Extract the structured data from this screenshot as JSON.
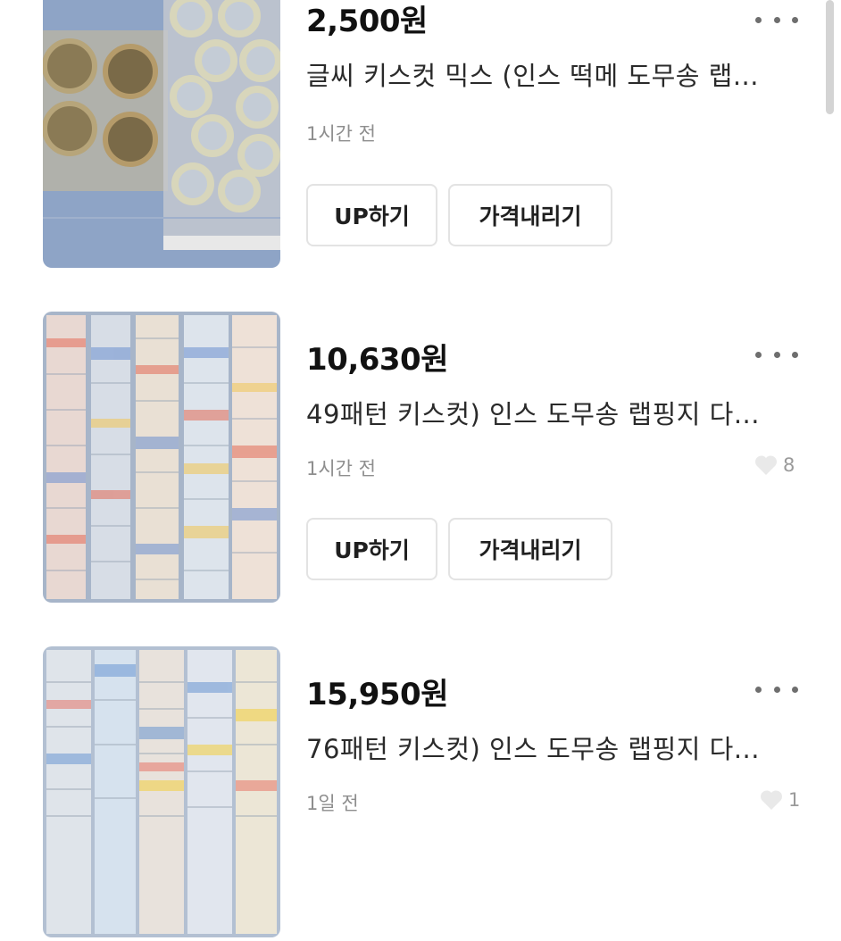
{
  "listings": [
    {
      "price": "2,500원",
      "title": "글씨 키스컷 믹스 (인스 떡메 도무송 랩...",
      "time": "1시간 전",
      "likes": "",
      "buttons": {
        "up": "UP하기",
        "lower_price": "가격내리기"
      }
    },
    {
      "price": "10,630원",
      "title": "49패턴 키스컷) 인스 도무송 랩핑지 다...",
      "time": "1시간 전",
      "likes": "8",
      "buttons": {
        "up": "UP하기",
        "lower_price": "가격내리기"
      }
    },
    {
      "price": "15,950원",
      "title": "76패턴 키스컷) 인스 도무송 랩핑지 다...",
      "time": "1일 전",
      "likes": "1"
    }
  ],
  "icons": {
    "more": "more-dots-icon",
    "like": "heart-icon"
  },
  "colors": {
    "text": "#111111",
    "muted": "#8e8e8e",
    "button_border": "#e3e3e3"
  }
}
